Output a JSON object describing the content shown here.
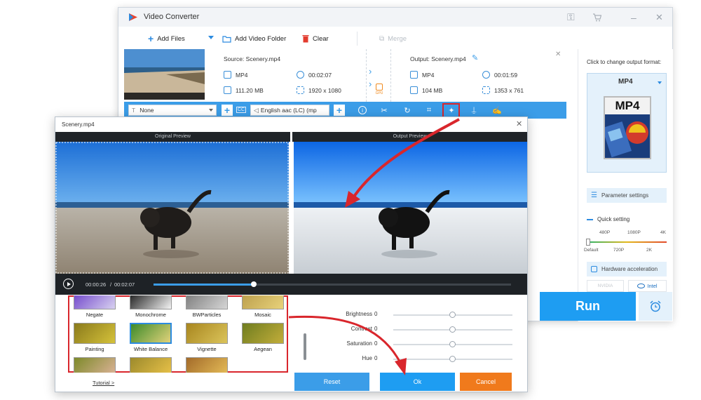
{
  "main_window": {
    "title": "Video Converter",
    "toolbar": {
      "add_files": "Add Files",
      "add_video_folder": "Add Video Folder",
      "clear": "Clear",
      "merge": "Merge"
    },
    "file": {
      "source_label": "Source: Scenery.mp4",
      "output_label": "Output: Scenery.mp4",
      "src_format": "MP4",
      "src_duration": "00:02:07",
      "src_size": "111.20 MB",
      "src_resolution": "1920 x 1080",
      "out_format": "MP4",
      "out_duration": "00:01:59",
      "out_size": "104 MB",
      "out_resolution": "1353 x 761",
      "gpu_badge": "GPU"
    },
    "blue_bar": {
      "subtitle_value": "None",
      "audio_value": "English aac (LC) (mp",
      "cc_label": "CC"
    }
  },
  "sidebar": {
    "change_format_hint": "Click to change output format:",
    "format": "MP4",
    "format_icon_text": "MP4",
    "parameter_settings": "Parameter settings",
    "quick_setting": "Quick setting",
    "quality_top": [
      "480P",
      "1080P",
      "4K"
    ],
    "quality_bottom": [
      "Default",
      "720P",
      "2K"
    ],
    "hardware_acceleration": "Hardware acceleration",
    "nvidia": "NVIDIA",
    "intel": "Intel",
    "run": "Run"
  },
  "editor": {
    "title": "Scenery.mp4",
    "original_preview": "Original Preview",
    "output_preview": "Output Preview",
    "time_current": "00:00:26",
    "time_separator": "/",
    "time_total": "00:02:07",
    "progress": 0.28,
    "filters": [
      {
        "label": "Negate"
      },
      {
        "label": "Monochrome"
      },
      {
        "label": "BWParticles"
      },
      {
        "label": "Mosaic"
      },
      {
        "label": "Painting"
      },
      {
        "label": "White Balance"
      },
      {
        "label": "Vignette"
      },
      {
        "label": "Aegean"
      },
      {
        "label": ""
      },
      {
        "label": ""
      },
      {
        "label": ""
      }
    ],
    "adjustments": [
      {
        "label": "Brightness",
        "value": "0"
      },
      {
        "label": "Contrast",
        "value": "0"
      },
      {
        "label": "Saturation",
        "value": "0"
      },
      {
        "label": "Hue",
        "value": "0"
      }
    ],
    "tutorial": "Tutorial >",
    "reset": "Reset",
    "ok": "Ok",
    "cancel": "Cancel"
  },
  "colors": {
    "accent_blue": "#3b9de8",
    "run_blue": "#1e9df2",
    "cancel_orange": "#f07a1c",
    "highlight_red": "#d9262c"
  }
}
